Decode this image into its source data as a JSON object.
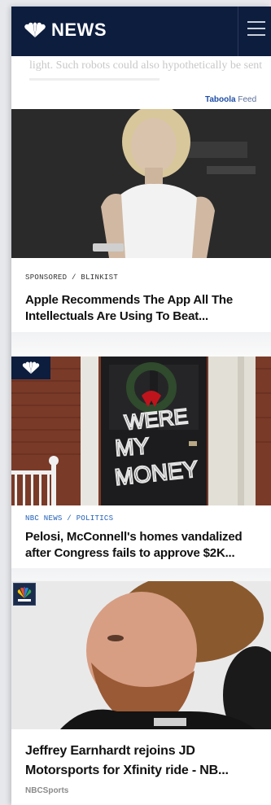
{
  "header": {
    "logo_text": "NEWS",
    "menu_icon": "hamburger-menu-icon",
    "background": "#0c1d3e"
  },
  "article_tail": {
    "line1": "light. Such robots could also hypothetically be sent to"
  },
  "feed": {
    "brand_bold": "Taboola",
    "brand_label": "Feed"
  },
  "cards": [
    {
      "kicker": "SPONSORED / BLINKIST",
      "headline": "Apple Recommends The App All The Intellectuals Are Using To Beat...",
      "image_icon": "woman-holding-phone-photo"
    },
    {
      "kicker": "NBC NEWS / POLITICS",
      "headline": "Pelosi, McConnell's homes vandalized after Congress fails to approve $2K...",
      "image_icon": "vandalized-door-photo",
      "graffiti": "WHERES MY MONEY",
      "badge_icon": "nbc-peacock-icon"
    },
    {
      "headline": "Jeffrey Earnhardt rejoins JD Motorsports for Xfinity ride - NB...",
      "source": "NBCSports",
      "image_icon": "bearded-driver-photo",
      "badge_icon": "nbc-sports-icon"
    }
  ],
  "colors": {
    "kicker_link": "#1f5fb8",
    "navy": "#0c1d3e"
  }
}
